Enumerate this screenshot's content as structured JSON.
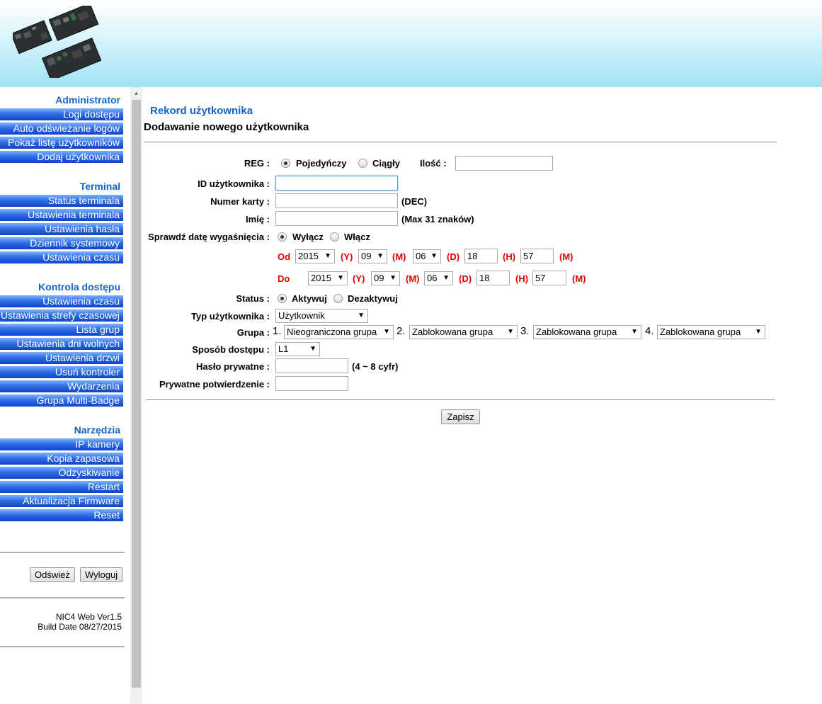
{
  "sidebar": {
    "sections": [
      {
        "title": "Administrator",
        "items": [
          "Logi dostępu",
          "Auto odświeżanie logów",
          "Pokaż listę użytkowników",
          "Dodaj użytkownika"
        ]
      },
      {
        "title": "Terminal",
        "items": [
          "Status terminala",
          "Ustawienia terminala",
          "Ustawienia hasła",
          "Dziennik systemowy",
          "Ustawienia czasu"
        ]
      },
      {
        "title": "Kontrola dostępu",
        "items": [
          "Ustawienia czasu",
          "Ustawienia strefy czasowej",
          "Lista grup",
          "Ustawienia dni wolnych",
          "Ustawienia drzwi",
          "Usuń kontroler",
          "Wydarzenia",
          "Grupa Multi-Badge"
        ]
      },
      {
        "title": "Narzędzia",
        "items": [
          "IP kamery",
          "Kopia zapasowa",
          "Odzyskiwanie",
          "Restart",
          "Aktualizacja Firmware",
          "Reset"
        ]
      }
    ],
    "refresh_label": "Odśwież",
    "logout_label": "Wyloguj",
    "version_line1": "NIC4 Web Ver1.5",
    "version_line2": "Build Date 08/27/2015"
  },
  "main": {
    "title": "Rekord użytkownika",
    "subtitle": "Dodawanie nowego użytkownika"
  },
  "form": {
    "reg_label": "REG :",
    "reg_single": "Pojedyńczy",
    "reg_continuous": "Ciągły",
    "reg_selected": "Pojedyńczy",
    "quantity_label": "Ilość :",
    "quantity_value": "",
    "user_id_label": "ID użytkownika :",
    "user_id_value": "",
    "card_label": "Numer karty :",
    "card_value": "",
    "card_hint": "(DEC)",
    "name_label": "Imię :",
    "name_value": "",
    "name_hint": "(Max 31 znaków)",
    "expiry_label": "Sprawdź datę wygaśnięcia :",
    "expiry_off": "Wyłącz",
    "expiry_on": "Włącz",
    "expiry_selected": "Wyłącz",
    "from_label": "Od",
    "to_label": "Do",
    "unit_y": "(Y)",
    "unit_m": "(M)",
    "unit_d": "(D)",
    "unit_h": "(H)",
    "unit_min": "(M)",
    "from": {
      "year": "2015",
      "month": "09",
      "day": "06",
      "hour": "18",
      "minute": "57"
    },
    "to": {
      "year": "2015",
      "month": "09",
      "day": "06",
      "hour": "18",
      "minute": "57"
    },
    "status_label": "Status :",
    "status_activate": "Aktywuj",
    "status_deactivate": "Dezaktywuj",
    "status_selected": "Aktywuj",
    "user_type_label": "Typ użytkownika :",
    "user_type_value": "Użytkownik",
    "group_label": "Grupa :",
    "group_num_1": "1.",
    "group_num_2": "2.",
    "group_num_3": "3.",
    "group_num_4": "4.",
    "group_1": "Nieograniczona grupa",
    "group_2": "Zablokowana grupa",
    "group_3": "Zablokowana grupa",
    "group_4": "Zablokowana grupa",
    "access_label": "Sposób dostępu :",
    "access_value": "L1",
    "password_label": "Hasło prywatne :",
    "password_value": "",
    "password_hint": "(4 ~ 8 cyfr)",
    "confirm_label": "Prywatne potwierdzenie :",
    "confirm_value": "",
    "save_label": "Zapisz"
  }
}
